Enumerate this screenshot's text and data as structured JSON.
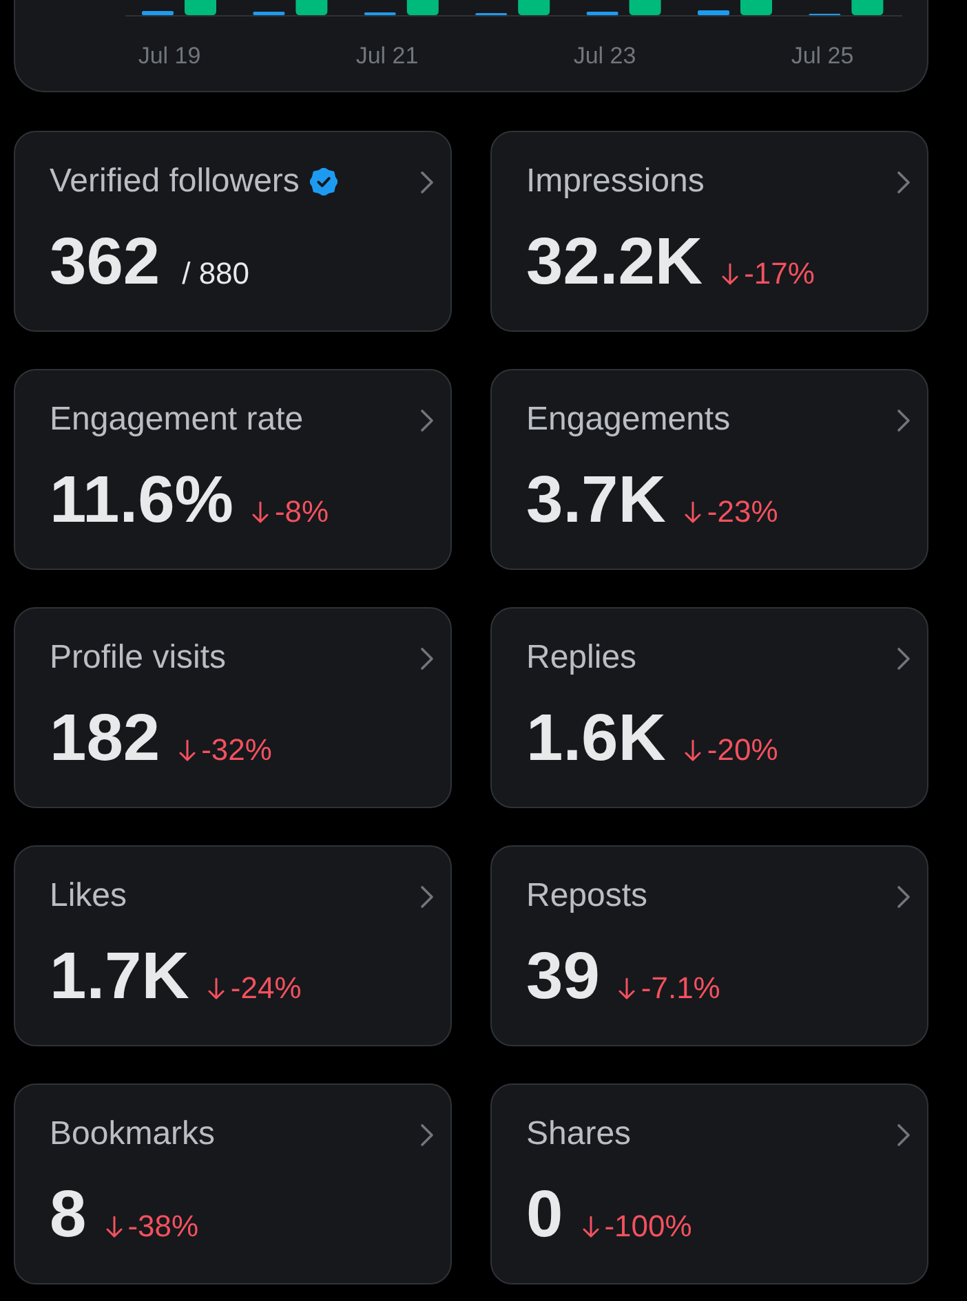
{
  "chart": {
    "x_labels": [
      "Jul 19",
      "Jul 21",
      "Jul 23",
      "Jul 25"
    ]
  },
  "metrics": [
    {
      "title": "Verified followers",
      "verified": true,
      "value": "362",
      "total": "/ 880"
    },
    {
      "title": "Impressions",
      "verified": false,
      "value": "32.2K",
      "decrease": true,
      "change": "-17%"
    },
    {
      "title": "Engagement rate",
      "verified": false,
      "value": "11.6%",
      "decrease": true,
      "change": "-8%"
    },
    {
      "title": "Engagements",
      "verified": false,
      "value": "3.7K",
      "decrease": true,
      "change": "-23%"
    },
    {
      "title": "Profile visits",
      "verified": false,
      "value": "182",
      "decrease": true,
      "change": "-32%"
    },
    {
      "title": "Replies",
      "verified": false,
      "value": "1.6K",
      "decrease": true,
      "change": "-20%"
    },
    {
      "title": "Likes",
      "verified": false,
      "value": "1.7K",
      "decrease": true,
      "change": "-24%"
    },
    {
      "title": "Reposts",
      "verified": false,
      "value": "39",
      "decrease": true,
      "change": "-7.1%"
    },
    {
      "title": "Bookmarks",
      "verified": false,
      "value": "8",
      "decrease": true,
      "change": "-38%"
    },
    {
      "title": "Shares",
      "verified": false,
      "value": "0",
      "decrease": true,
      "change": "-100%"
    }
  ]
}
